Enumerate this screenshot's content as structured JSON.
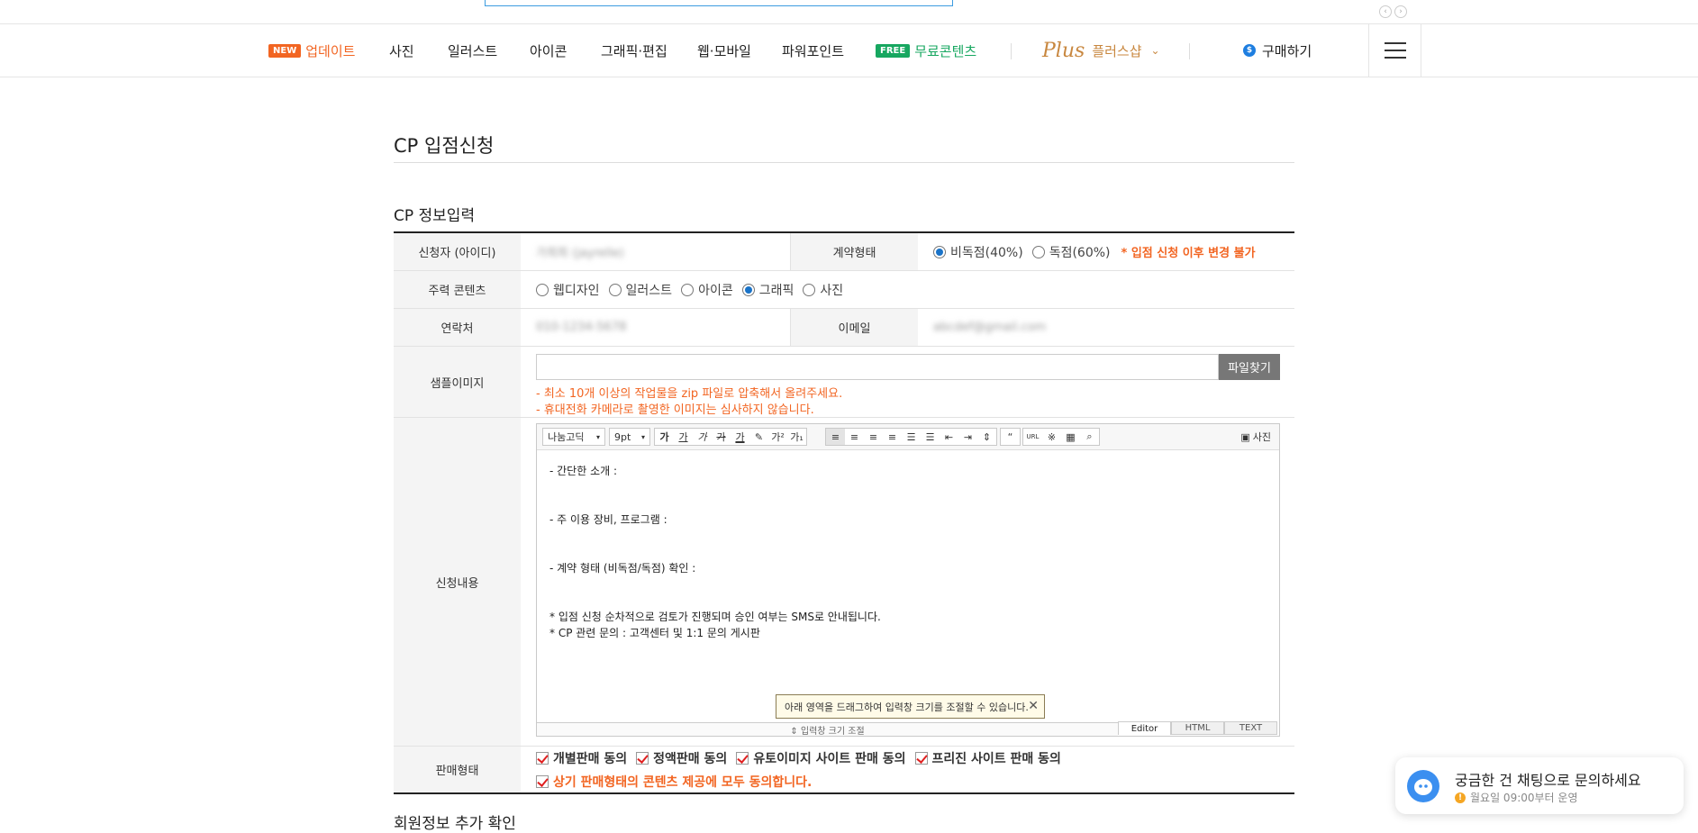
{
  "nav": {
    "new_badge": "NEW",
    "update": "업데이트",
    "photo": "사진",
    "illust": "일러스트",
    "icon": "아이콘",
    "graphic": "그래픽·편집",
    "web": "웹·모바일",
    "ppt": "파워포인트",
    "free_badge": "FREE",
    "free": "무료콘텐츠",
    "plus_logo": "Plus",
    "plus_shop": "플러스샵",
    "buy": "구매하기"
  },
  "page_title": "CP 입점신청",
  "section_title": "CP 정보입력",
  "form": {
    "applicant_label": "신청자 (아이디)",
    "applicant_value": "가희희 (jayrelle)",
    "contract_label": "계약형태",
    "contract_options": [
      "비독점(40%)",
      "독점(60%)"
    ],
    "contract_selected": "비독점(40%)",
    "contract_note": "* 입점 신청 이후 변경 불가",
    "content_label": "주력 콘텐츠",
    "content_options": [
      "웹디자인",
      "일러스트",
      "아이콘",
      "그래픽",
      "사진"
    ],
    "content_selected": "그래픽",
    "phone_label": "연락처",
    "phone_value": "010-1234-5678",
    "email_label": "이메일",
    "email_value": "abcdef@gmail.com",
    "sample_label": "샘플이미지",
    "file_button": "파일찾기",
    "hint1": "- 최소 10개 이상의 작업물을 zip 파일로 압축해서 올려주세요.",
    "hint2": "- 휴대전화 카메라로 촬영한 이미지는 심사하지 않습니다.",
    "content_apply_label": "신청내용",
    "sale_label": "판매형태",
    "sale_options": [
      "개별판매 동의",
      "정액판매 동의",
      "유토이미지 사이트 판매 동의",
      "프리진 사이트 판매 동의"
    ],
    "sale_agree_all": "상기 판매형태의 콘텐츠 제공에 모두 동의합니다."
  },
  "editor": {
    "font": "나눔고딕",
    "size": "9pt",
    "photo_button": "사진",
    "line1": "- 간단한 소개 :",
    "line2": "- 주 이용 장비, 프로그램 :",
    "line3": "- 계약 형태 (비독점/독점) 확인 :",
    "line4": "* 입점 신청 순차적으로 검토가 진행되며 승인 여부는 SMS로 안내됩니다.",
    "line5": "* CP 관련 문의 : 고객센터 및 1:1 문의 게시판",
    "tooltip": "아래 영역을 드래그하여 입력창 크기를 조절할 수 있습니다.",
    "resize": "⇕ 입력창 크기 조절",
    "mode_editor": "Editor",
    "mode_html": "HTML",
    "mode_text": "TEXT"
  },
  "next_section": "회원정보 추가 확인",
  "chat": {
    "title": "궁금한 건 채팅으로 문의하세요",
    "sub": "월요일 09:00부터 운영"
  },
  "colors": {
    "accent": "#f26522",
    "free": "#17a760",
    "plus": "#c8873f",
    "radio": "#1a73c8"
  }
}
